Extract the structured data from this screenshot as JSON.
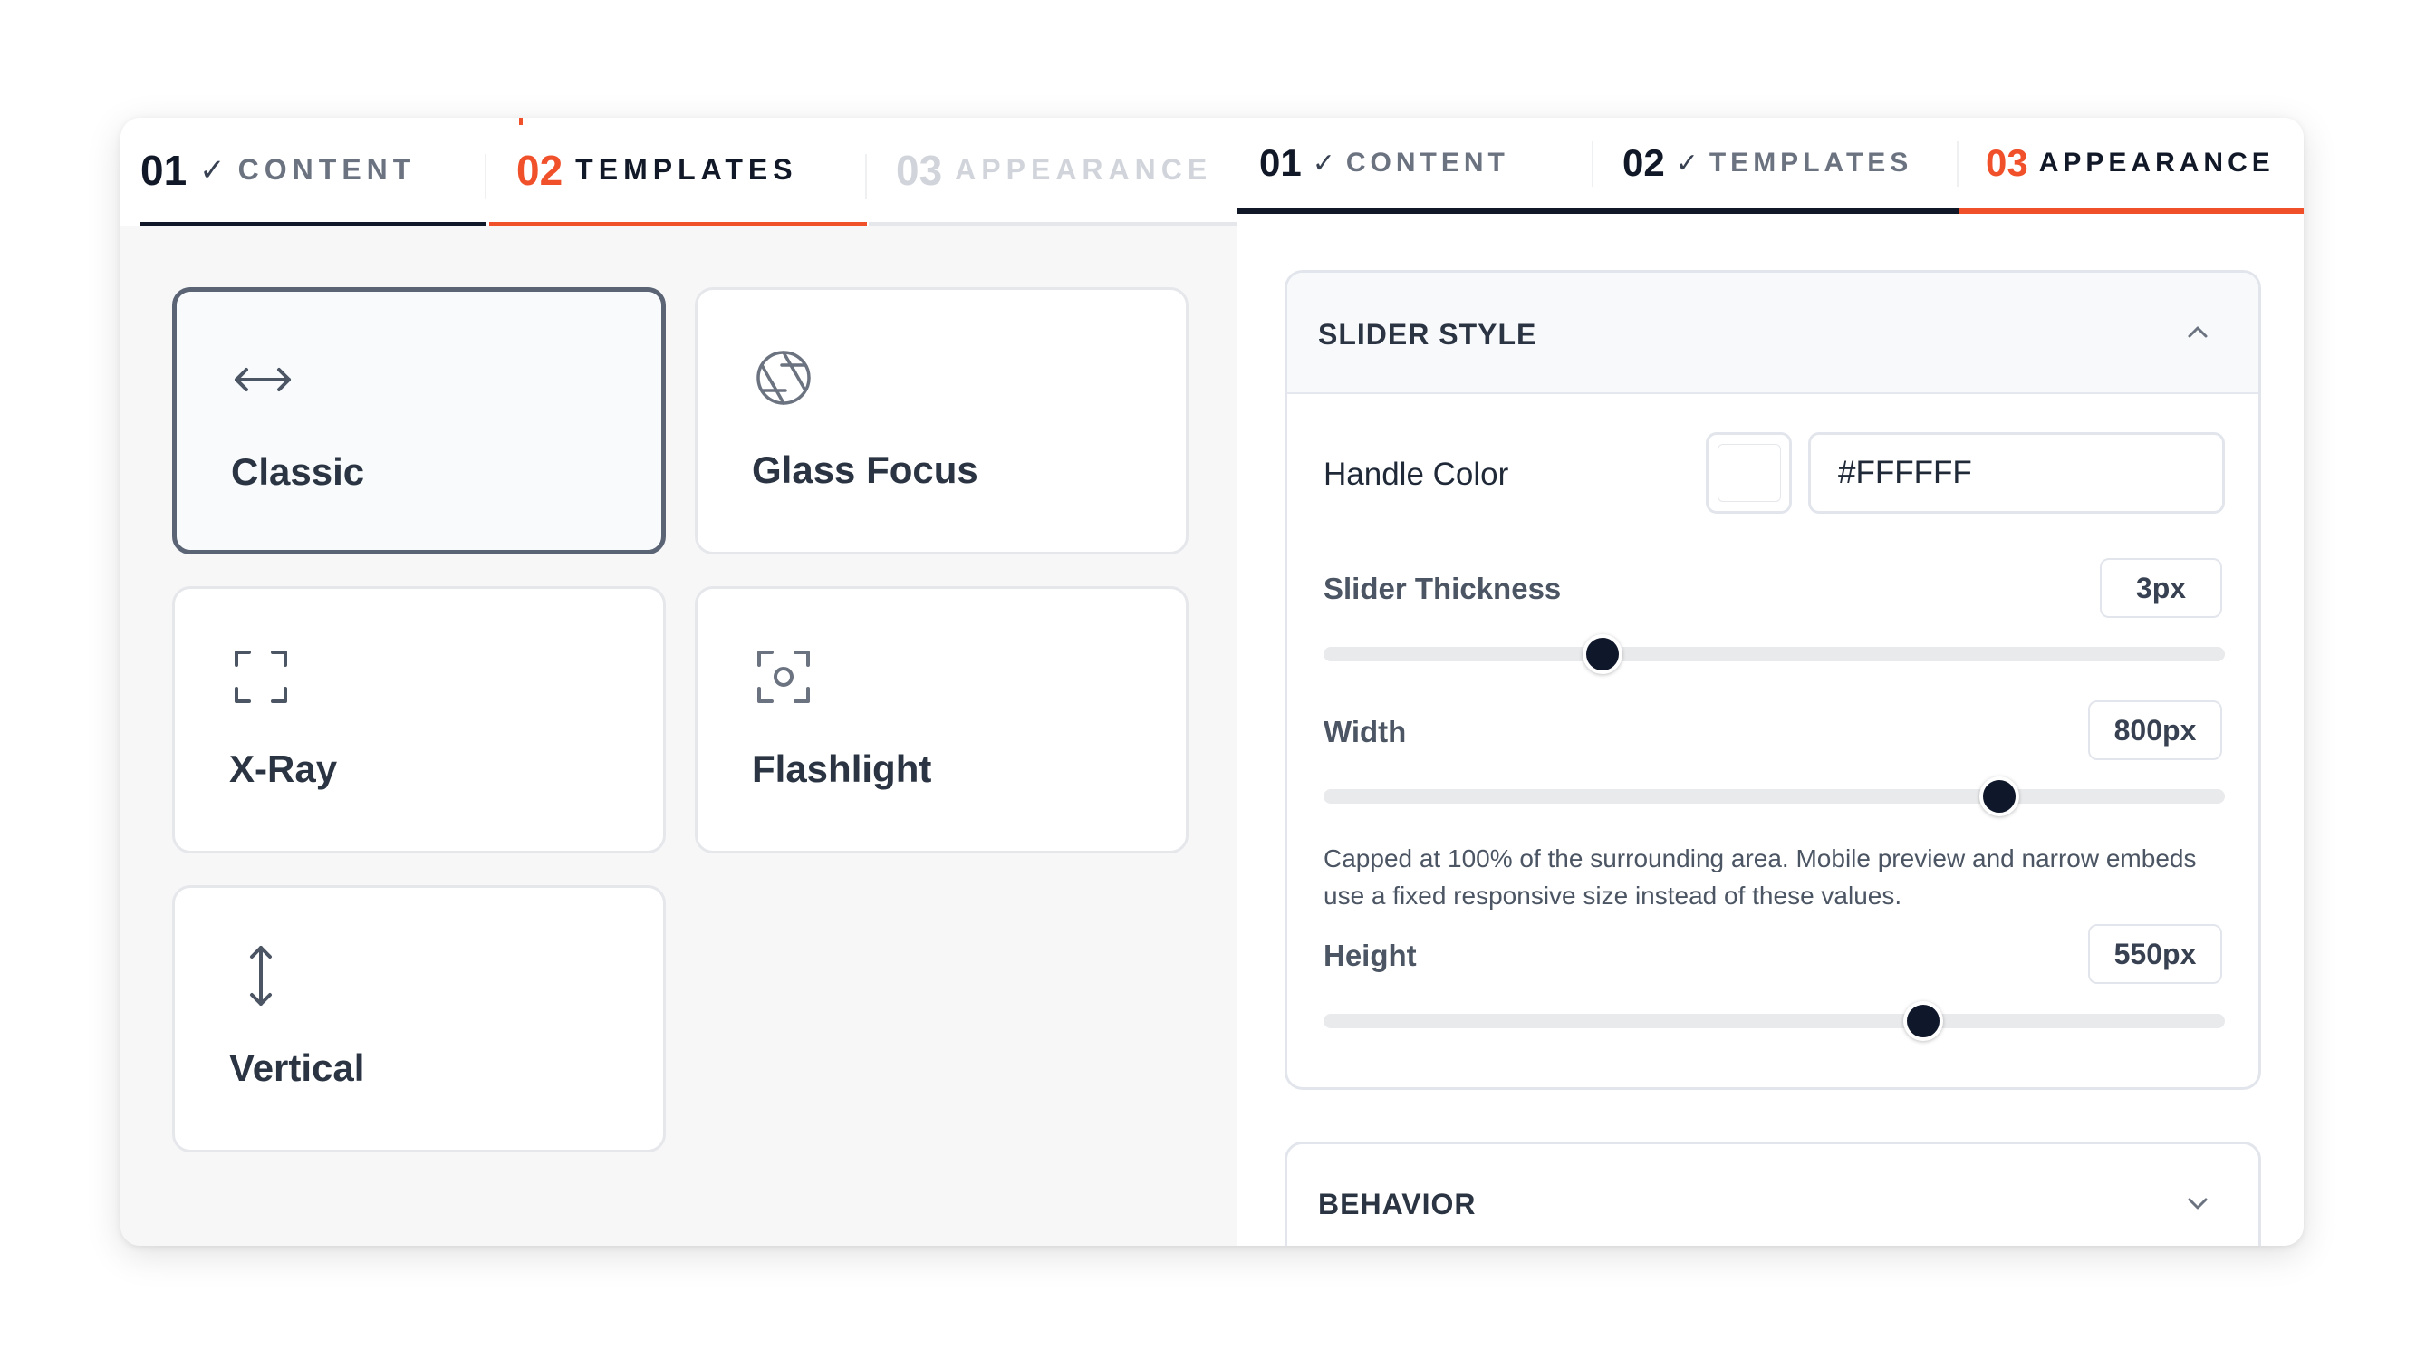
{
  "left_panel": {
    "tabs": [
      {
        "num": "01",
        "label": "CONTENT",
        "status": "done"
      },
      {
        "num": "02",
        "label": "TEMPLATES",
        "status": "active"
      },
      {
        "num": "03",
        "label": "APPEARANCE",
        "status": "pending"
      }
    ],
    "templates": [
      {
        "name": "Classic",
        "icon": "horizontal-arrows-icon",
        "selected": true
      },
      {
        "name": "Glass Focus",
        "icon": "aperture-icon",
        "selected": false
      },
      {
        "name": "X-Ray",
        "icon": "scan-corners-icon",
        "selected": false
      },
      {
        "name": "Flashlight",
        "icon": "focus-circle-icon",
        "selected": false
      },
      {
        "name": "Vertical",
        "icon": "vertical-arrows-icon",
        "selected": false
      }
    ]
  },
  "right_panel": {
    "tabs": [
      {
        "num": "01",
        "label": "CONTENT",
        "status": "done"
      },
      {
        "num": "02",
        "label": "TEMPLATES",
        "status": "done"
      },
      {
        "num": "03",
        "label": "APPEARANCE",
        "status": "active"
      }
    ],
    "slider_style": {
      "title": "SLIDER STYLE",
      "handle_color_label": "Handle Color",
      "handle_color_value": "#FFFFFF",
      "thickness_label": "Slider Thickness",
      "thickness_value": "3px",
      "thickness_fraction": 0.31,
      "width_label": "Width",
      "width_value": "800px",
      "width_fraction": 0.75,
      "width_note": "Capped at 100% of the surrounding area. Mobile preview and narrow embeds use a fixed responsive size instead of these values.",
      "height_label": "Height",
      "height_value": "550px",
      "height_fraction": 0.665
    },
    "behavior": {
      "title": "BEHAVIOR"
    }
  },
  "colors": {
    "accent": "#f0502a",
    "dark": "#111827",
    "muted_tab": "#d1d5db",
    "thumb": "#0f172a"
  }
}
